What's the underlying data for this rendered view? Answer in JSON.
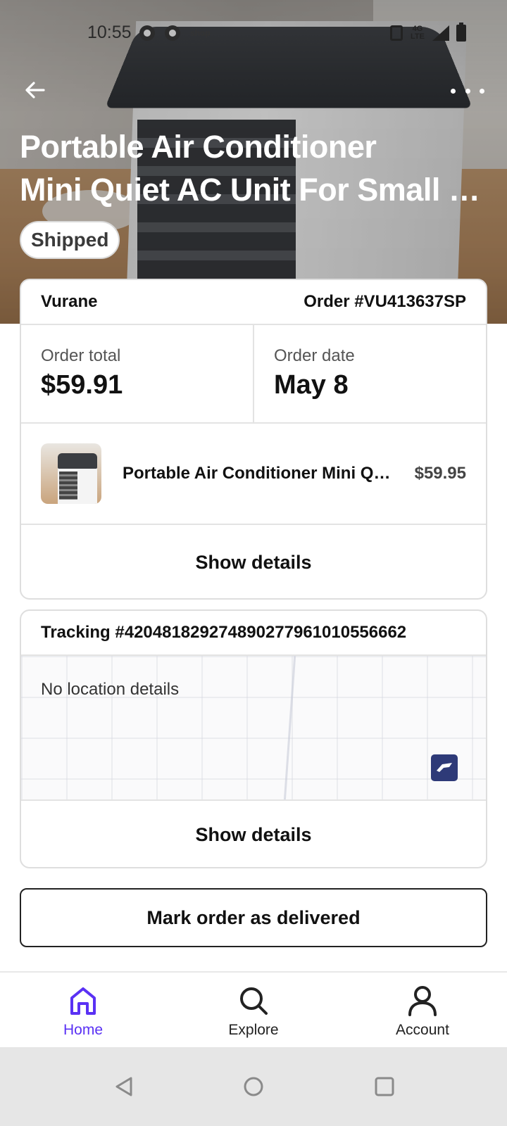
{
  "status_bar": {
    "time": "10:55",
    "shop_label": "shop",
    "network": "4G LTE"
  },
  "header": {
    "title_line1": "Portable Air Conditioner",
    "title_line2": "Mini Quiet AC Unit For Small Room",
    "status": "Shipped"
  },
  "order": {
    "merchant": "Vurane",
    "order_number": "Order #VU413637SP",
    "total_label": "Order total",
    "total_value": "$59.91",
    "date_label": "Order date",
    "date_value": "May 8",
    "item_name": "Portable Air Conditioner Mini Quiet AC Unit",
    "item_price": "$59.95",
    "details_label": "Show details"
  },
  "tracking": {
    "number": "Tracking #420481829274890277961010556662",
    "location_text": "No location details",
    "details_label": "Show details",
    "carrier_icon": "usps-eagle-icon"
  },
  "actions": {
    "mark_delivered": "Mark order as delivered"
  },
  "bottom_nav": {
    "items": [
      {
        "label": "Home",
        "icon": "home-icon",
        "active": true
      },
      {
        "label": "Explore",
        "icon": "search-icon",
        "active": false
      },
      {
        "label": "Account",
        "icon": "person-icon",
        "active": false
      }
    ]
  },
  "colors": {
    "accent": "#5a31f4",
    "usps": "#2e3a78"
  }
}
